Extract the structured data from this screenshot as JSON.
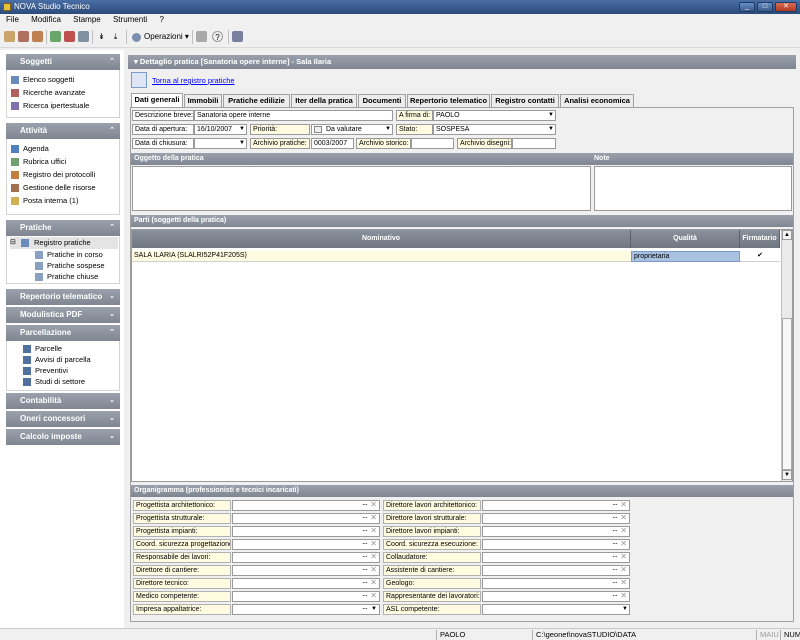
{
  "window": {
    "title": "NOVA Studio Tecnico"
  },
  "menu": [
    "File",
    "Modifica",
    "Stampe",
    "Strumenti",
    "?"
  ],
  "toolbar": {
    "operazioni": "Operazioni"
  },
  "sidebar": {
    "soggetti": {
      "title": "Soggetti",
      "items": [
        "Elenco soggetti",
        "Ricerche avanzate",
        "Ricerca ipertestuale"
      ]
    },
    "attivita": {
      "title": "Attività",
      "items": [
        "Agenda",
        "Rubrica uffici",
        "Registro dei protocolli",
        "Gestione delle risorse",
        "Posta interna (1)"
      ]
    },
    "pratiche": {
      "title": "Pratiche",
      "root": "Registro pratiche",
      "children": [
        "Pratiche in corso",
        "Pratiche sospese",
        "Pratiche chiuse"
      ]
    },
    "repertorio": "Repertorio telematico",
    "modulistica": "Modulistica PDF",
    "parcellazione": {
      "title": "Parcellazione",
      "items": [
        "Parcelle",
        "Avvisi di parcella",
        "Preventivi",
        "Studi di settore"
      ]
    },
    "contabilita": "Contabilità",
    "oneri": "Oneri concessori",
    "imposte": "Calcolo imposte"
  },
  "main": {
    "header": "Dettaglio pratica [Sanatoria opere interne] - Sala Ilaria",
    "back_link": "Torna al registro pratiche",
    "tabs": [
      "Dati generali",
      "Immobili",
      "Pratiche edilizie",
      "Iter della pratica",
      "Documenti",
      "Repertorio telematico",
      "Registro contatti",
      "Analisi economica"
    ],
    "form": {
      "descrizione_label": "Descrizione breve:",
      "descrizione_value": "Sanatoria opere interne",
      "firma_label": "A firma di:",
      "firma_value": "PAOLO",
      "apertura_label": "Data di apertura:",
      "apertura_value": "16/10/2007",
      "priorita_label": "Priorità:",
      "priorita_value": "Da valutare",
      "stato_label": "Stato:",
      "stato_value": "SOSPESA",
      "chiusura_label": "Data di chiusura:",
      "chiusura_value": "",
      "archivio_pratiche_label": "Archivio pratiche:",
      "archivio_pratiche_value": "0003/2007",
      "archivio_storico_label": "Archivio storico:",
      "archivio_storico_value": "",
      "archivio_disegni_label": "Archivio disegni:",
      "archivio_disegni_value": ""
    },
    "oggetto_title": "Oggetto della pratica",
    "note_title": "Note",
    "parti": {
      "title": "Parti (soggetti della pratica)",
      "columns": [
        "Nominativo",
        "Qualità",
        "Firmatario"
      ],
      "rows": [
        {
          "nominativo": "SALA ILARIA (SLALRI52P41F205S)",
          "qualita": "proprietaria",
          "firmatario": "✔"
        }
      ]
    },
    "organigramma": {
      "title": "Organigramma (professionisti e tecnici incaricati)",
      "left": [
        "Progettista architettonico:",
        "Progettista strutturale:",
        "Progettista impianti:",
        "Coord. sicurezza progettazione:",
        "Responsabile dei lavori:",
        "Direttore di cantiere:",
        "Direttore tecnico:",
        "Medico competente:",
        "Impresa appaltatrice:"
      ],
      "right": [
        "Direttore lavori architettonico:",
        "Direttore lavori strutturale:",
        "Direttore lavori impianti:",
        "Coord. sicurezza esecuzione:",
        "Collaudatore:",
        "Assistente di cantiere:",
        "Geologo:",
        "Rappresentante dei lavoratori:",
        "ASL competente:"
      ]
    }
  },
  "status": {
    "user": "PAOLO",
    "path": "C:\\geonet\\novaSTUDIO\\DATA",
    "maiu": "MAIU",
    "num": "NUM"
  }
}
